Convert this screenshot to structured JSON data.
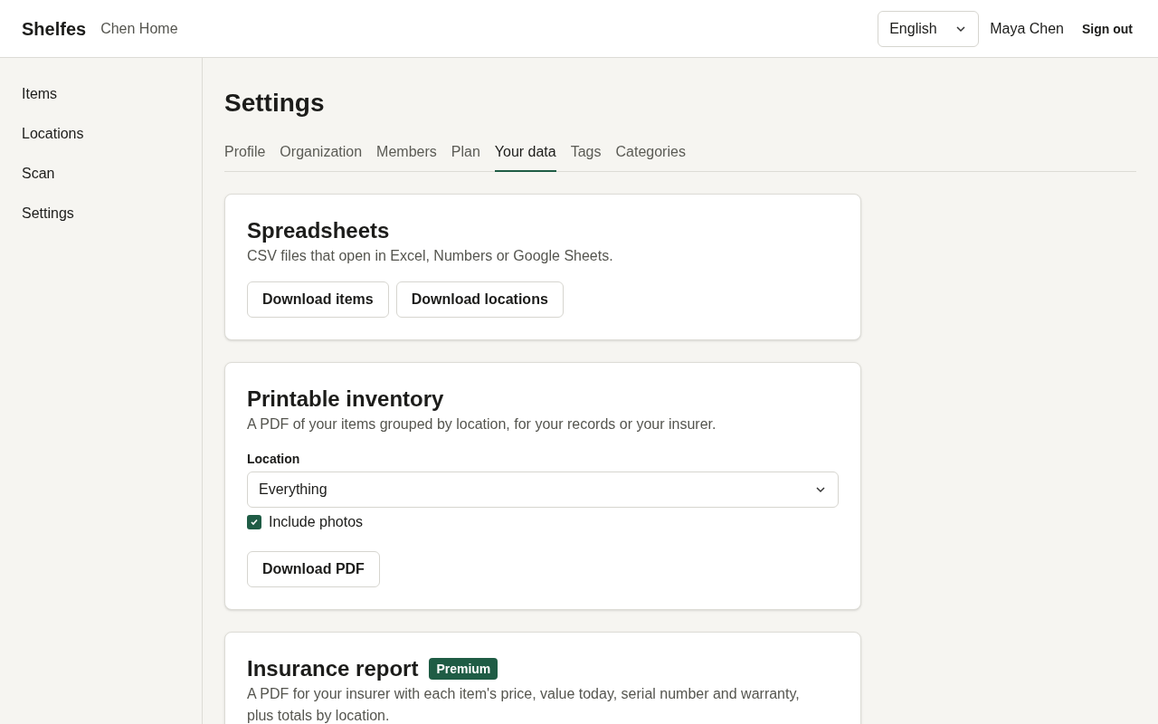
{
  "header": {
    "brand": "Shelfes",
    "home": "Chen Home",
    "language": "English",
    "user": "Maya Chen",
    "sign_out": "Sign out"
  },
  "sidebar": {
    "items": [
      {
        "label": "Items",
        "selected": false
      },
      {
        "label": "Locations",
        "selected": false
      },
      {
        "label": "Scan",
        "selected": false
      },
      {
        "label": "Settings",
        "selected": false
      }
    ]
  },
  "page_title": "Settings",
  "tabs": [
    {
      "label": "Profile",
      "selected": false
    },
    {
      "label": "Organization",
      "selected": false
    },
    {
      "label": "Members",
      "selected": false
    },
    {
      "label": "Plan",
      "selected": false
    },
    {
      "label": "Your data",
      "selected": true
    },
    {
      "label": "Tags",
      "selected": false
    },
    {
      "label": "Categories",
      "selected": false
    }
  ],
  "cards": [
    {
      "title": "Spreadsheets",
      "description": "CSV files that open in Excel, Numbers or Google Sheets.",
      "buttons": [
        "Download items",
        "Download locations"
      ]
    },
    {
      "title": "Printable inventory",
      "description": "A PDF of your items grouped by location, for your records or your insurer.",
      "select": {
        "label": "Location",
        "value": "Everything"
      },
      "checkbox": {
        "label": "Include photos",
        "checked": true
      },
      "buttons": [
        "Download PDF"
      ]
    },
    {
      "title": "Insurance report",
      "badge": "Premium",
      "description": "A PDF for your insurer with each item's price, value today, serial number and warranty, plus totals by location."
    }
  ]
}
